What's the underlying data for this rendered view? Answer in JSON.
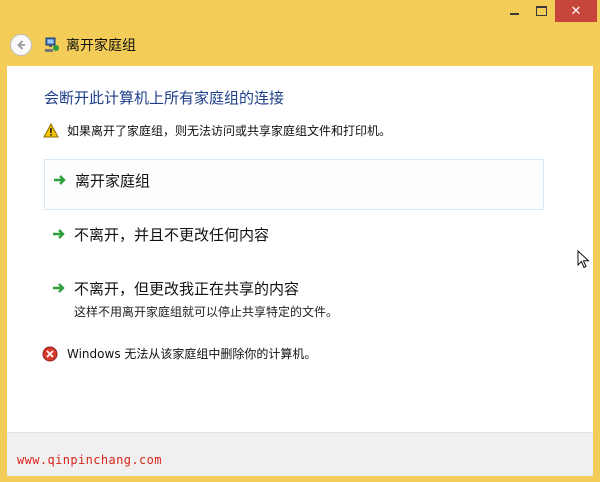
{
  "window": {
    "title": "离开家庭组",
    "minimize_icon": "minimize-icon",
    "maximize_icon": "maximize-icon",
    "close_icon": "close-icon",
    "close_glyph": "✕"
  },
  "nav": {
    "back_icon": "back-arrow-icon",
    "app_icon": "homegroup-icon",
    "title": "离开家庭组"
  },
  "content": {
    "heading": "会断开此计算机上所有家庭组的连接",
    "warning": "如果离开了家庭组，则无法访问或共享家庭组文件和打印机。",
    "options": [
      {
        "label": "离开家庭组",
        "description": ""
      },
      {
        "label": "不离开，并且不更改任何内容",
        "description": ""
      },
      {
        "label": "不离开，但更改我正在共享的内容",
        "description": "这样不用离开家庭组就可以停止共享特定的文件。"
      }
    ],
    "error": "Windows 无法从该家庭组中删除你的计算机。"
  },
  "footer": {
    "watermark": "www.qinpinchang.com"
  },
  "colors": {
    "accent_title": "#1e3f8a",
    "arrow_green": "#2e9e3c",
    "close_red": "#c7453a",
    "frame_yellow": "#f3cd57",
    "watermark_red": "#d8261b"
  }
}
